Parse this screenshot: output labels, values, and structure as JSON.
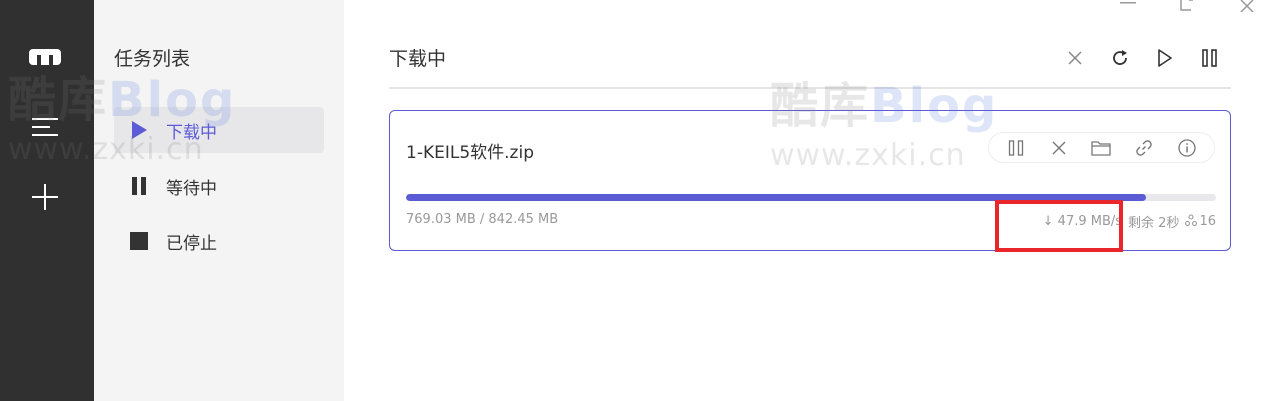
{
  "sidebar_rail": {
    "icons": [
      "logo-icon",
      "menu-icon",
      "add-icon"
    ]
  },
  "tasklist": {
    "title": "任务列表",
    "items": [
      {
        "label": "下载中",
        "icon": "play-icon",
        "active": true
      },
      {
        "label": "等待中",
        "icon": "pause-icon",
        "active": false
      },
      {
        "label": "已停止",
        "icon": "stop-icon",
        "active": false
      }
    ]
  },
  "main": {
    "heading": "下载中",
    "toolbar": [
      "close-icon",
      "refresh-icon",
      "play-icon",
      "pause-icon"
    ]
  },
  "task": {
    "filename": "1-KEIL5软件.zip",
    "progress_fraction": 0.913,
    "size_text": "769.03 MB / 842.45 MB",
    "speed_text": "↓ 47.9 MB/s",
    "remaining_text": "剩余 2秒",
    "connections_text": "16",
    "actions": [
      "pause-icon",
      "close-icon",
      "folder-icon",
      "link-icon",
      "info-icon"
    ]
  },
  "watermark": {
    "big_1": "酷库",
    "big_2": "Blog",
    "small": "www.zxki.cn"
  },
  "colors": {
    "accent": "#5b5bd6",
    "rail": "#303030",
    "panel": "#f4f4f4",
    "highlight": "#e8262b"
  }
}
